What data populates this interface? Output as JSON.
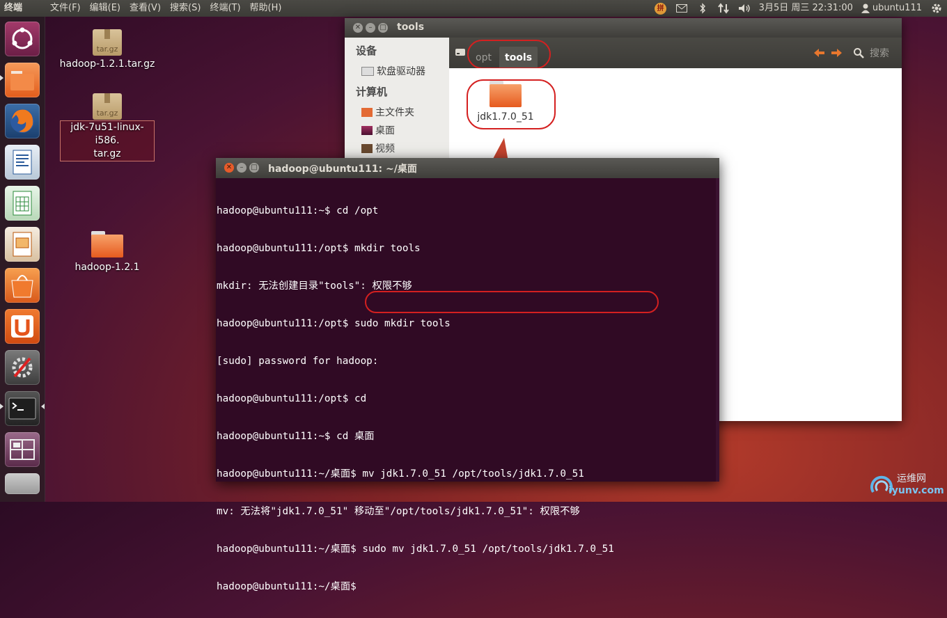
{
  "top_panel": {
    "app_name": "终端",
    "menus": [
      "文件(F)",
      "编辑(E)",
      "查看(V)",
      "搜索(S)",
      "终端(T)",
      "帮助(H)"
    ],
    "input_method": "拼",
    "datetime": "3月5日 周三 22:31:00",
    "username": "ubuntu111"
  },
  "launcher": {
    "items": [
      "dash-home",
      "files",
      "firefox",
      "libreoffice-writer",
      "libreoffice-calc",
      "libreoffice-impress",
      "ubuntu-software-center",
      "ubuntu-one",
      "system-settings",
      "terminal",
      "workspace-switcher",
      "trash"
    ]
  },
  "desktop": {
    "icons": [
      {
        "label": "hadoop-1.2.1.tar.gz",
        "type": "archive",
        "badge": "tar.gz"
      },
      {
        "label": "jdk-7u51-linux-i586.tar.gz",
        "line1": "jdk-7u51-linux-i586.",
        "line2": "tar.gz",
        "type": "archive",
        "badge": "tar.gz"
      },
      {
        "label": "hadoop-1.2.1",
        "type": "folder"
      }
    ]
  },
  "file_manager": {
    "title": "tools",
    "sidebar": {
      "devices_header": "设备",
      "devices": [
        "软盘驱动器"
      ],
      "computer_header": "计算机",
      "places": [
        "主文件夹",
        "桌面",
        "视频"
      ]
    },
    "breadcrumbs": [
      "opt",
      "tools"
    ],
    "search_label": "搜索",
    "items": [
      {
        "name": "jdk1.7.0_51",
        "type": "folder"
      }
    ]
  },
  "terminal": {
    "title": "hadoop@ubuntu111: ~/桌面",
    "lines": [
      "hadoop@ubuntu111:~$ cd /opt",
      "hadoop@ubuntu111:/opt$ mkdir tools",
      "mkdir: 无法创建目录\"tools\": 权限不够",
      "hadoop@ubuntu111:/opt$ sudo mkdir tools",
      "[sudo] password for hadoop:",
      "hadoop@ubuntu111:/opt$ cd",
      "hadoop@ubuntu111:~$ cd 桌面",
      "hadoop@ubuntu111:~/桌面$ mv jdk1.7.0_51 /opt/tools/jdk1.7.0_51",
      "mv: 无法将\"jdk1.7.0_51\" 移动至\"/opt/tools/jdk1.7.0_51\": 权限不够",
      "hadoop@ubuntu111:~/桌面$ sudo mv jdk1.7.0_51 /opt/tools/jdk1.7.0_51",
      "hadoop@ubuntu111:~/桌面$ "
    ]
  },
  "watermark": {
    "text1": "运维网",
    "text2": "iyunv.com"
  },
  "colors": {
    "terminal_bg": "#300a24",
    "annotation_red": "#d42020",
    "arrow": "#c5442f",
    "folder_orange": "#ef6c2d"
  }
}
